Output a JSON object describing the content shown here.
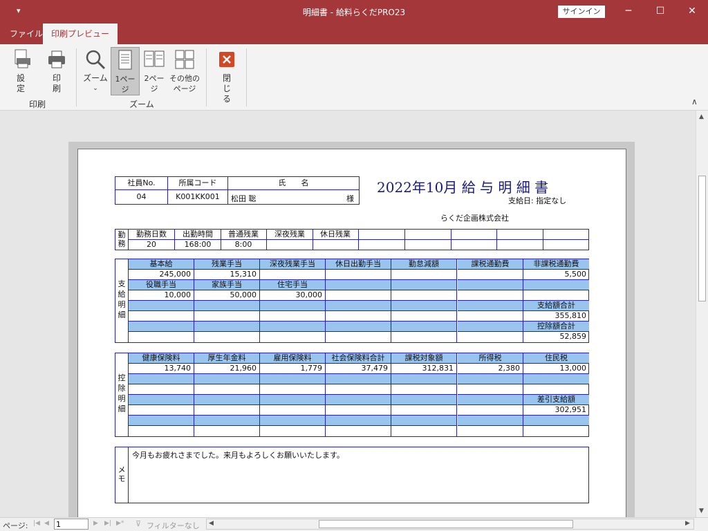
{
  "window": {
    "quick_access": "▾",
    "title": "明細書  -  給料らくだPRO23",
    "signin_label": "サインイン",
    "min_glyph": "─",
    "max_glyph": "☐",
    "close_glyph": "✕"
  },
  "tabs": [
    {
      "label": "ファイル"
    },
    {
      "label": "印刷プレビュー"
    }
  ],
  "ribbon": {
    "setup_label": "設定",
    "print_label": "印刷",
    "group_print": "印刷",
    "zoom_label": "ズーム",
    "one_page_label": "1ページ",
    "two_page_label": "2ページ",
    "other_pages_label": "その他のページ",
    "group_zoom": "ズーム",
    "close_label": "閉じる",
    "collapse_glyph": "∧"
  },
  "payslip": {
    "header_labels": [
      "社員No.",
      "所属コード",
      "氏　　名"
    ],
    "emp_no": "04",
    "dept_code": "K001KK001",
    "name": "松田 聡",
    "sama": "様",
    "title": "2022年10月 給 与 明 細 書",
    "pay_date": "支給日: 指定なし",
    "company": "らくだ企画株式会社",
    "attendance_side": "勤務",
    "attendance_headers": [
      "勤務日数",
      "出勤時間",
      "普通残業",
      "深夜残業",
      "休日残業",
      "",
      "",
      "",
      "",
      ""
    ],
    "attendance_values": [
      "20",
      "168:00",
      "8:00",
      "",
      "",
      "",
      "",
      "",
      "",
      ""
    ],
    "pay_side": "支給明細",
    "pay_rows": [
      [
        "基本給",
        "残業手当",
        "深夜残業手当",
        "休日出勤手当",
        "勤怠減額",
        "課税通勤費",
        "非課税通勤費"
      ],
      [
        "245,000",
        "15,310",
        "",
        "",
        "",
        "",
        "5,500"
      ],
      [
        "役職手当",
        "家族手当",
        "住宅手当",
        "",
        "",
        "",
        ""
      ],
      [
        "10,000",
        "50,000",
        "30,000",
        "",
        "",
        "",
        ""
      ],
      [
        "",
        "",
        "",
        "",
        "",
        "",
        "支給額合計"
      ],
      [
        "",
        "",
        "",
        "",
        "",
        "",
        "355,810"
      ],
      [
        "",
        "",
        "",
        "",
        "",
        "",
        "控除額合計"
      ],
      [
        "",
        "",
        "",
        "",
        "",
        "",
        "52,859"
      ]
    ],
    "deduct_side": "控除明細",
    "deduct_rows": [
      [
        "健康保険料",
        "厚生年金料",
        "雇用保険料",
        "社会保険料合計",
        "課税対象額",
        "所得税",
        "住民税"
      ],
      [
        "13,740",
        "21,960",
        "1,779",
        "37,479",
        "312,831",
        "2,380",
        "13,000"
      ],
      [
        "",
        "",
        "",
        "",
        "",
        "",
        ""
      ],
      [
        "",
        "",
        "",
        "",
        "",
        "",
        ""
      ],
      [
        "",
        "",
        "",
        "",
        "",
        "",
        "差引支給額"
      ],
      [
        "",
        "",
        "",
        "",
        "",
        "",
        "302,951"
      ],
      [
        "",
        "",
        "",
        "",
        "",
        "",
        ""
      ],
      [
        "",
        "",
        "",
        "",
        "",
        "",
        ""
      ]
    ],
    "memo_side": "メモ",
    "memo_text": "今月もお疲れさまでした。来月もよろしくお願いいたします。"
  },
  "status": {
    "page_label": "ページ:",
    "page_value": "1",
    "filter_label": "フィルターなし"
  },
  "colors": {
    "accent": "#a4373a",
    "header_fill": "#99c4ee",
    "border": "#2222bb"
  }
}
